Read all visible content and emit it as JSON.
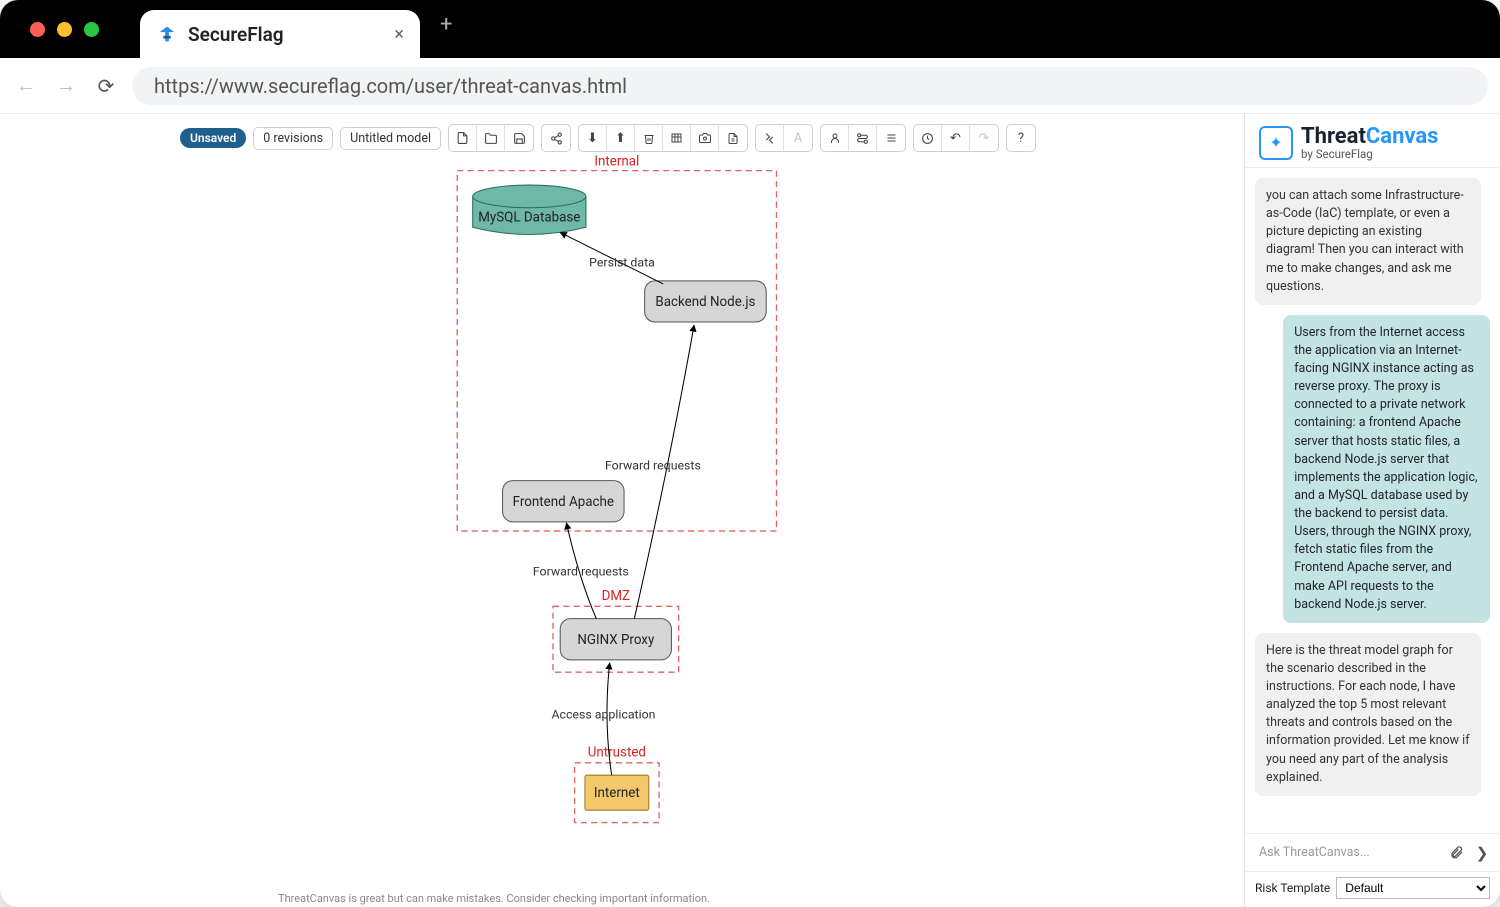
{
  "browser": {
    "tab_title": "SecureFlag",
    "url": "https://www.secureflag.com/user/threat-canvas.html"
  },
  "toolbar": {
    "unsaved": "Unsaved",
    "revisions": "0 revisions",
    "model_name": "Untitled model"
  },
  "zones": {
    "internal": "Internal",
    "dmz": "DMZ",
    "untrusted": "Untrusted"
  },
  "nodes": {
    "db": "MySQL Database",
    "backend": "Backend Node.js",
    "frontend": "Frontend Apache",
    "proxy": "NGINX Proxy",
    "internet": "Internet"
  },
  "edges": {
    "persist": "Persist data",
    "fwd1": "Forward requests",
    "fwd2": "Forward requests",
    "access": "Access application"
  },
  "sidebar": {
    "brand_a": "Threat",
    "brand_b": "Canvas",
    "brand_sub": "by SecureFlag",
    "chat": {
      "ai1": "you can attach some Infrastructure-as-Code (IaC) template, or even a picture depicting an existing diagram!\n\nThen you can interact with me to make changes, and ask me questions.",
      "user1": "Users from the Internet access the application via an Internet-facing NGINX instance acting as reverse proxy. The proxy is connected to a private network containing: a frontend Apache server that hosts static files, a backend Node.js server that implements the application logic, and a MySQL database used by the backend to persist data. Users, through the NGINX proxy, fetch static files from the Frontend Apache server, and make API requests to the backend Node.js server.",
      "ai2": "Here is the threat model graph for the scenario described in the instructions.\n\nFor each node, I have analyzed the top 5 most relevant threats and controls based on the information provided. Let me know if you need any part of the analysis explained."
    },
    "input_placeholder": "Ask ThreatCanvas...",
    "risk_label": "Risk Template",
    "risk_value": "Default"
  },
  "footer": "ThreatCanvas is great but can make mistakes. Consider checking important information."
}
